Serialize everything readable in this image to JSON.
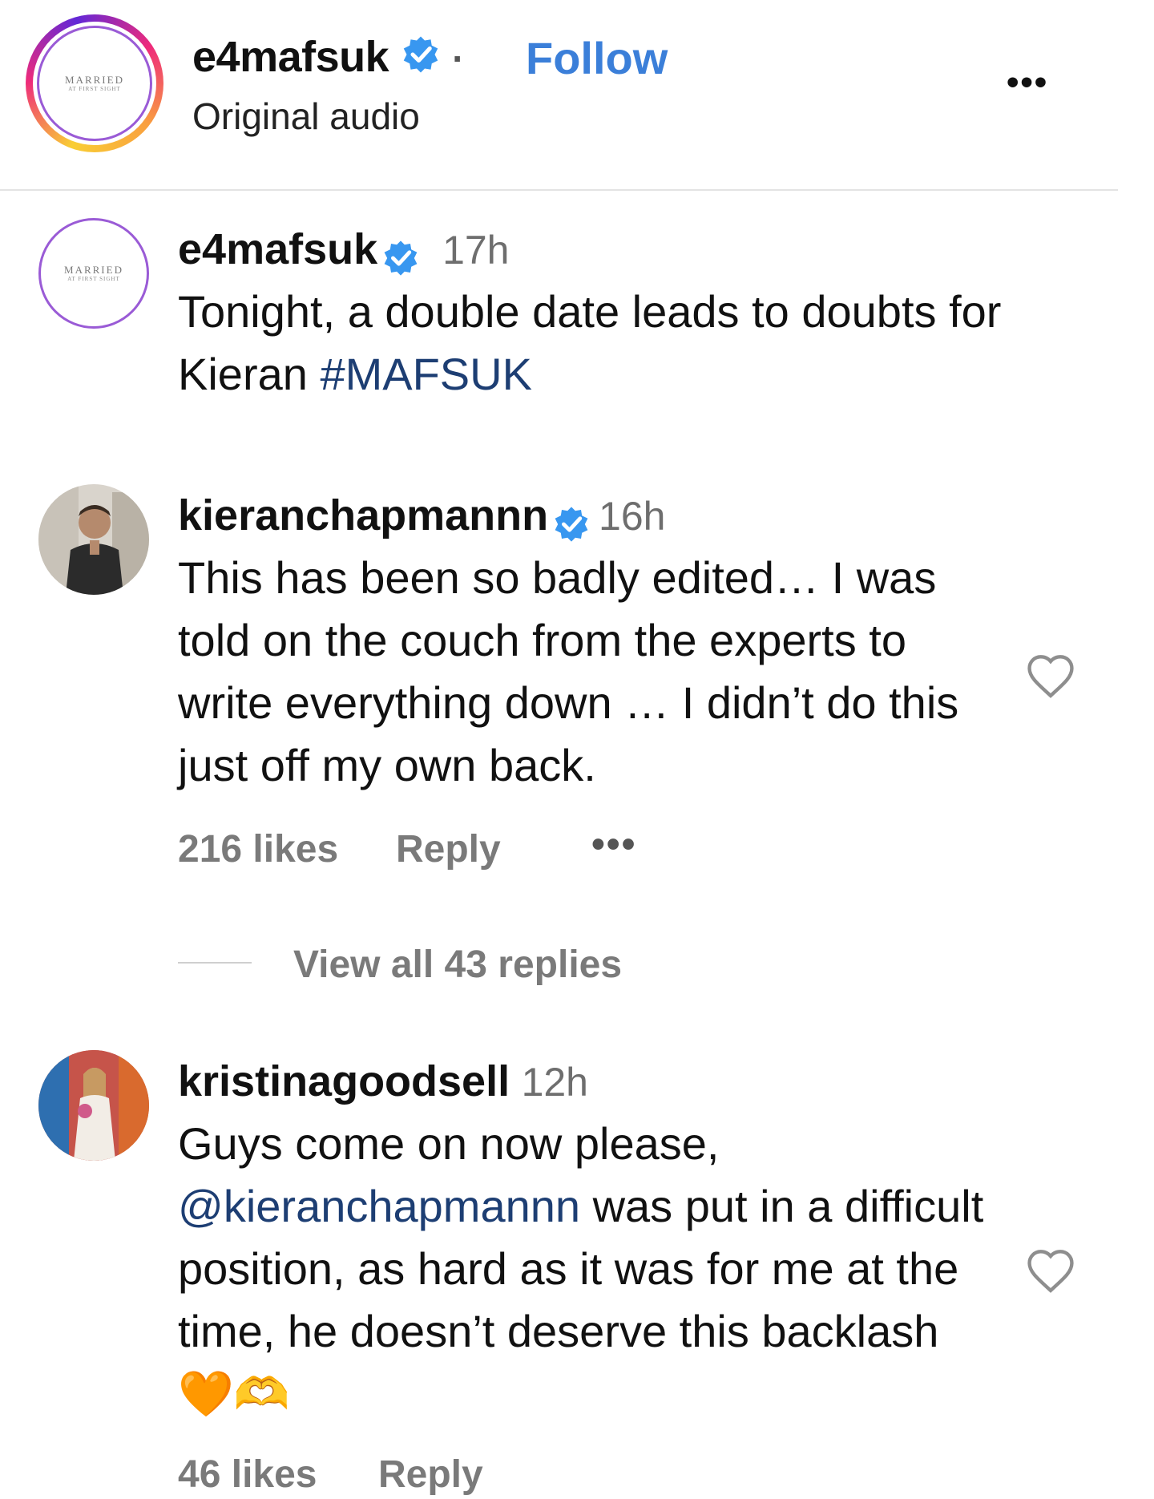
{
  "header": {
    "username": "e4mafsuk",
    "separator": "·",
    "follow_label": "Follow",
    "subtitle": "Original audio",
    "more_label": "•••",
    "logo_line1": "MARRIED",
    "logo_line2": "AT FIRST SIGHT"
  },
  "caption": {
    "username": "e4mafsuk",
    "time": "17h",
    "text_main": "Tonight, a double date leads to doubts for Kieran ",
    "hashtag": "#MAFSUK",
    "logo_line1": "MARRIED",
    "logo_line2": "AT FIRST SIGHT"
  },
  "comments": [
    {
      "username": "kieranchapmannn",
      "time": "16h",
      "text": "This has been so badly edited… I was told on the couch from the experts to write everything down … I didn’t do this just off my own back.",
      "likes": "216 likes",
      "reply_label": "Reply",
      "more_label": "•••",
      "view_replies": "View all 43 replies"
    },
    {
      "username": "kristinagoodsell",
      "time": "12h",
      "text_before": "Guys come on now please, ",
      "mention": "@kieranchapmannn",
      "text_after": " was put in a difficult position, as hard as it was for me at the time, he doesn’t deserve this backlash ",
      "emoji": "🧡🫶",
      "likes": "46 likes",
      "reply_label": "Reply"
    }
  ],
  "colors": {
    "link_blue": "#3b7fd9",
    "hashtag_navy": "#1d3e73",
    "verified_blue": "#3897f0",
    "muted_gray": "#7a7a7a"
  },
  "icons": [
    "verified-badge-icon",
    "more-icon",
    "heart-icon"
  ]
}
